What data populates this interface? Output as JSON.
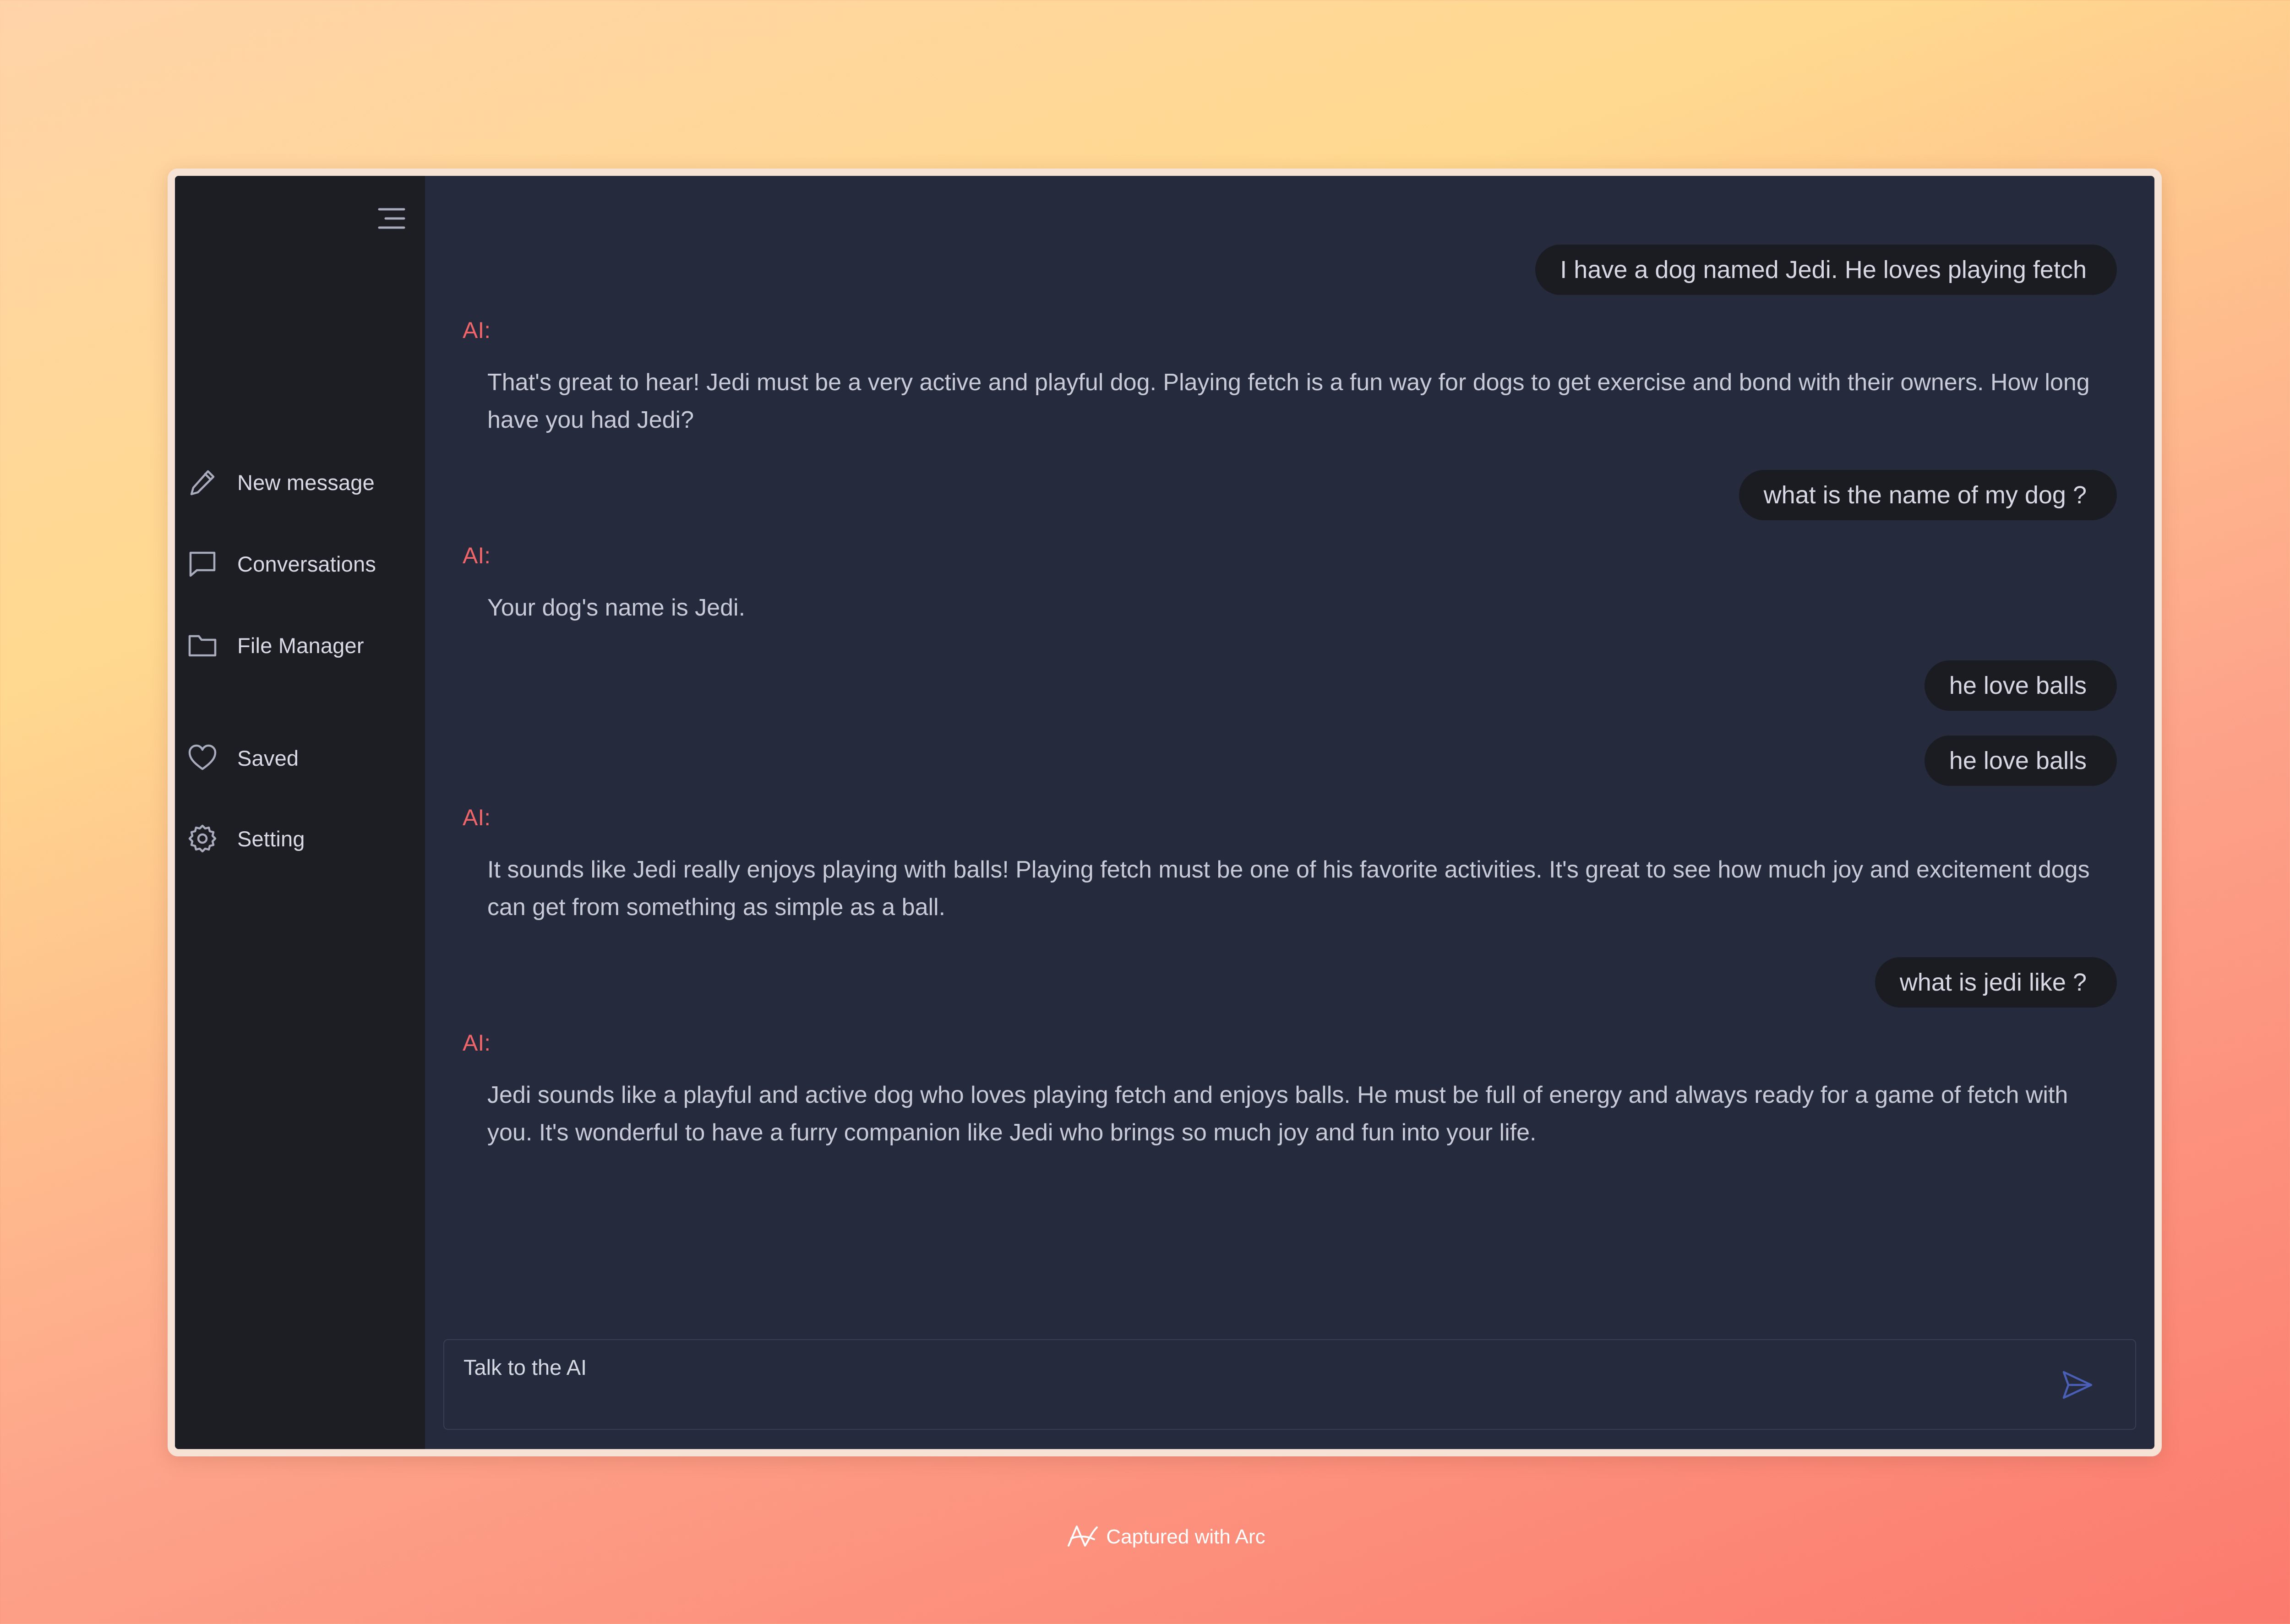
{
  "sidebar": {
    "items": [
      {
        "label": "New message",
        "icon": "pencil-icon"
      },
      {
        "label": "Conversations",
        "icon": "chat-bubble-icon"
      },
      {
        "label": "File Manager",
        "icon": "folder-icon"
      },
      {
        "label": "Saved",
        "icon": "heart-icon"
      },
      {
        "label": "Setting",
        "icon": "gear-icon"
      }
    ]
  },
  "chat": {
    "ai_label": "AI:",
    "messages": [
      {
        "role": "user",
        "text": "I have a dog named Jedi. He loves playing fetch"
      },
      {
        "role": "ai",
        "text": "That's great to hear! Jedi must be a very active and playful dog. Playing fetch is a fun way for dogs to get exercise and bond with their owners. How long have you had Jedi?"
      },
      {
        "role": "user",
        "text": "what is the name of my dog ?"
      },
      {
        "role": "ai",
        "text": "Your dog's name is Jedi."
      },
      {
        "role": "user",
        "text": "he love balls"
      },
      {
        "role": "user",
        "text": "he love balls"
      },
      {
        "role": "ai",
        "text": "It sounds like Jedi really enjoys playing with balls! Playing fetch must be one of his favorite activities. It's great to see how much joy and excitement dogs can get from something as simple as a ball."
      },
      {
        "role": "user",
        "text": "what is jedi like ?"
      },
      {
        "role": "ai",
        "text": "Jedi sounds like a playful and active dog who loves playing fetch and enjoys balls. He must be full of energy and always ready for a game of fetch with you. It's wonderful to have a furry companion like Jedi who brings so much joy and fun into your life."
      }
    ]
  },
  "input": {
    "placeholder": "Talk to the AI",
    "value": ""
  },
  "footer": {
    "text": "Captured with Arc"
  },
  "colors": {
    "sidebar_bg": "#1d1e23",
    "main_bg": "#262a3d",
    "ai_label": "#f0656a",
    "send_icon": "#4a5fb8"
  }
}
